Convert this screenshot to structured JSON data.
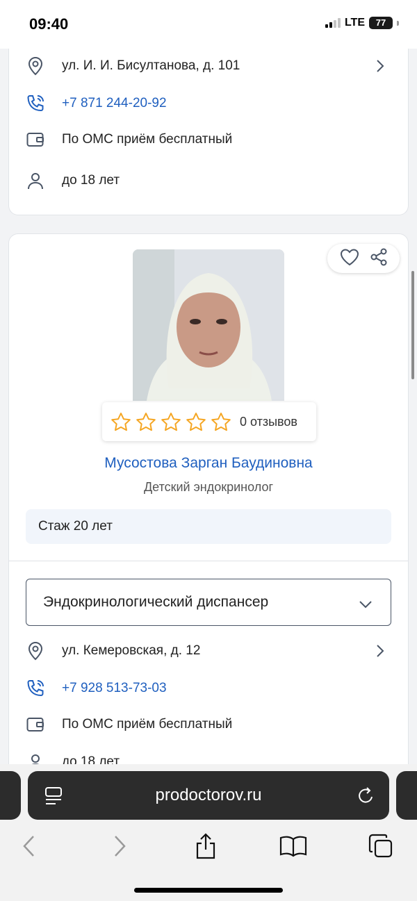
{
  "status_bar": {
    "time": "09:40",
    "network": "LTE",
    "battery": "77"
  },
  "clinic_card_top": {
    "address": "ул. И. И. Бисултанова, д. 101",
    "phone": "+7 871 244-20-92",
    "payment": "По ОМС приём бесплатный",
    "age": "до 18 лет"
  },
  "doctor": {
    "reviews": "0 отзывов",
    "rating_stars": 0,
    "name": "Мусостова Зарган Баудиновна",
    "specialty": "Детский эндокринолог",
    "experience": "Стаж 20 лет",
    "clinic_select": "Эндокринологический диспансер",
    "address": "ул. Кемеровская, д. 12",
    "phone": "+7 928 513-73-03",
    "payment": "По ОМС приём бесплатный",
    "age_partial": "до 18 лет"
  },
  "browser": {
    "url": "prodoctorov.ru"
  },
  "colors": {
    "link": "#1f5fbf",
    "star": "#f5a623",
    "experience_bg": "#f1f5fb"
  },
  "icons": {
    "location": "location-pin-icon",
    "phone": "phone-icon",
    "wallet": "wallet-icon",
    "person": "person-icon",
    "heart": "heart-icon",
    "share": "share-icon",
    "star": "star-outline-icon"
  }
}
